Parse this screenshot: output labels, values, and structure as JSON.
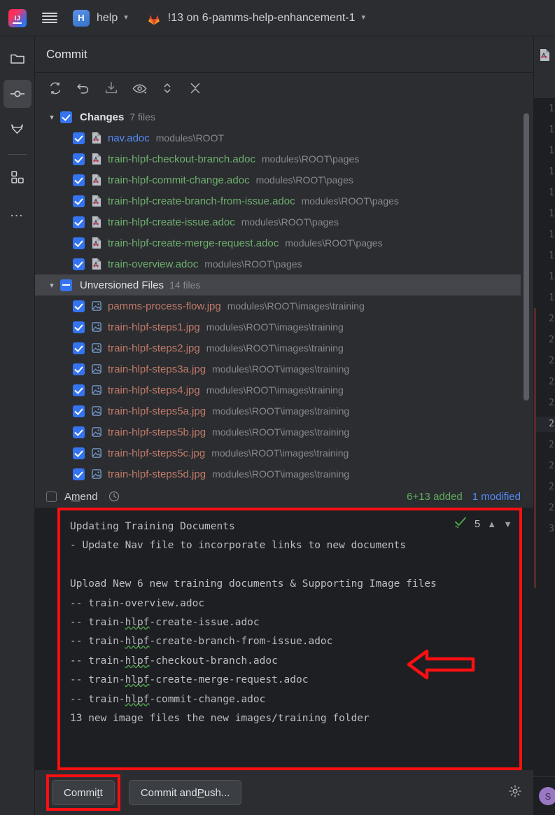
{
  "titlebar": {
    "logo_icon": "intellij-idea-logo",
    "menu_icon": "hamburger-menu-icon",
    "project_badge": "H",
    "project_name": "help",
    "project_chevron": "chevron-down-icon",
    "vcs_icon": "gitlab-fox-icon",
    "branch_label": "!13 on 6-pamms-help-enhancement-1",
    "branch_chevron": "chevron-down-icon"
  },
  "toolstrip": {
    "items": [
      {
        "name": "project-folder",
        "icon": "folder-icon",
        "active": false
      },
      {
        "name": "commit",
        "icon": "commit-node-icon",
        "active": true
      },
      {
        "name": "gitlab",
        "icon": "gitlab-fox-icon",
        "active": false
      },
      {
        "name": "plugins",
        "icon": "grid-blocks-icon",
        "active": false
      },
      {
        "name": "more",
        "icon": "more-dots-icon",
        "active": false
      }
    ]
  },
  "commit_panel": {
    "title": "Commit",
    "toolbar": [
      {
        "name": "refresh-changes",
        "icon": "refresh-icon"
      },
      {
        "name": "rollback",
        "icon": "undo-arrow-icon"
      },
      {
        "name": "update-project",
        "icon": "download-icon"
      },
      {
        "name": "show-diff-preview",
        "icon": "eye-icon"
      },
      {
        "name": "expand-collapse",
        "icon": "expand-collapse-icon"
      },
      {
        "name": "collapse-all",
        "icon": "collapse-all-icon"
      }
    ],
    "groups": [
      {
        "label": "Changes",
        "count": "7 files",
        "checkbox": "checked",
        "twisty": "chevron-down-icon",
        "selected": false,
        "files": [
          {
            "name": "nav.adoc",
            "path": "modules\\ROOT",
            "status": "modified",
            "icon": "adoc-file-icon",
            "checkbox": "checked"
          },
          {
            "name": "train-hlpf-checkout-branch.adoc",
            "path": "modules\\ROOT\\pages",
            "status": "added",
            "icon": "adoc-file-icon",
            "checkbox": "checked"
          },
          {
            "name": "train-hlpf-commit-change.adoc",
            "path": "modules\\ROOT\\pages",
            "status": "added",
            "icon": "adoc-file-icon",
            "checkbox": "checked"
          },
          {
            "name": "train-hlpf-create-branch-from-issue.adoc",
            "path": "modules\\ROOT\\pages",
            "status": "added",
            "icon": "adoc-file-icon",
            "checkbox": "checked"
          },
          {
            "name": "train-hlpf-create-issue.adoc",
            "path": "modules\\ROOT\\pages",
            "status": "added",
            "icon": "adoc-file-icon",
            "checkbox": "checked"
          },
          {
            "name": "train-hlpf-create-merge-request.adoc",
            "path": "modules\\ROOT\\pages",
            "status": "added",
            "icon": "adoc-file-icon",
            "checkbox": "checked"
          },
          {
            "name": "train-overview.adoc",
            "path": "modules\\ROOT\\pages",
            "status": "added",
            "icon": "adoc-file-icon",
            "checkbox": "checked"
          }
        ]
      },
      {
        "label": "Unversioned Files",
        "count": "14 files",
        "checkbox": "partial",
        "twisty": "chevron-down-icon",
        "selected": true,
        "files": [
          {
            "name": "pamms-process-flow.jpg",
            "path": "modules\\ROOT\\images\\training",
            "status": "unversioned",
            "icon": "image-file-icon",
            "checkbox": "checked"
          },
          {
            "name": "train-hlpf-steps1.jpg",
            "path": "modules\\ROOT\\images\\training",
            "status": "unversioned",
            "icon": "image-file-icon",
            "checkbox": "checked"
          },
          {
            "name": "train-hlpf-steps2.jpg",
            "path": "modules\\ROOT\\images\\training",
            "status": "unversioned",
            "icon": "image-file-icon",
            "checkbox": "checked"
          },
          {
            "name": "train-hlpf-steps3a.jpg",
            "path": "modules\\ROOT\\images\\training",
            "status": "unversioned",
            "icon": "image-file-icon",
            "checkbox": "checked"
          },
          {
            "name": "train-hlpf-steps4.jpg",
            "path": "modules\\ROOT\\images\\training",
            "status": "unversioned",
            "icon": "image-file-icon",
            "checkbox": "checked"
          },
          {
            "name": "train-hlpf-steps5a.jpg",
            "path": "modules\\ROOT\\images\\training",
            "status": "unversioned",
            "icon": "image-file-icon",
            "checkbox": "checked"
          },
          {
            "name": "train-hlpf-steps5b.jpg",
            "path": "modules\\ROOT\\images\\training",
            "status": "unversioned",
            "icon": "image-file-icon",
            "checkbox": "checked"
          },
          {
            "name": "train-hlpf-steps5c.jpg",
            "path": "modules\\ROOT\\images\\training",
            "status": "unversioned",
            "icon": "image-file-icon",
            "checkbox": "checked"
          },
          {
            "name": "train-hlpf-steps5d.jpg",
            "path": "modules\\ROOT\\images\\training",
            "status": "unversioned",
            "icon": "image-file-icon",
            "checkbox": "checked"
          }
        ]
      }
    ],
    "amend": {
      "label_pre": "A",
      "label_mnemonic": "m",
      "label_post": "end",
      "checkbox": "unchecked",
      "history_icon": "clock-icon"
    },
    "stats": {
      "added": "6+13 added",
      "modified": "1 modified"
    },
    "message": {
      "lines": [
        "Updating Training Documents",
        "- Update Nav file to incorporate links to new documents",
        "",
        "Upload New 6 new training documents & Supporting Image files",
        "-- train-overview.adoc",
        "-- train-hlpf-create-issue.adoc",
        "-- train-hlpf-create-branch-from-issue.adoc",
        "-- train-hlpf-checkout-branch.adoc",
        "-- train-hlpf-create-merge-request.adoc",
        "-- train-hlpf-commit-change.adoc",
        "13 new image files the new images/training folder"
      ],
      "spellcheck_icon": "spellcheck-ok-icon",
      "spellcheck_count": "5",
      "prev_icon": "chevron-up-icon",
      "next_icon": "chevron-down-icon",
      "highlight_color": "#fa0f12"
    },
    "buttons": {
      "commit": "Commit",
      "commit_mnemonic": "t",
      "commit_and_push_pre": "Commit and ",
      "commit_and_push_mnemonic": "P",
      "commit_and_push_post": "ush...",
      "settings_icon": "gear-icon",
      "commit_highlight_color": "#fa0f12"
    }
  },
  "editor_sliver": {
    "tab_icon": "adoc-file-icon",
    "line_numbers": [
      "1",
      "1",
      "1",
      "1",
      "1",
      "1",
      "1",
      "1",
      "1",
      "1",
      "2",
      "2",
      "2",
      "2",
      "2",
      "2",
      "2",
      "2",
      "2",
      "2",
      "3"
    ],
    "current_line_index": 15
  },
  "status_bar": {
    "avatar_initial": "S",
    "avatar_color": "#9a78c4"
  },
  "annotation": {
    "arrow_icon": "left-pointing-arrow-annotation",
    "arrow_color": "#fa0f12"
  }
}
